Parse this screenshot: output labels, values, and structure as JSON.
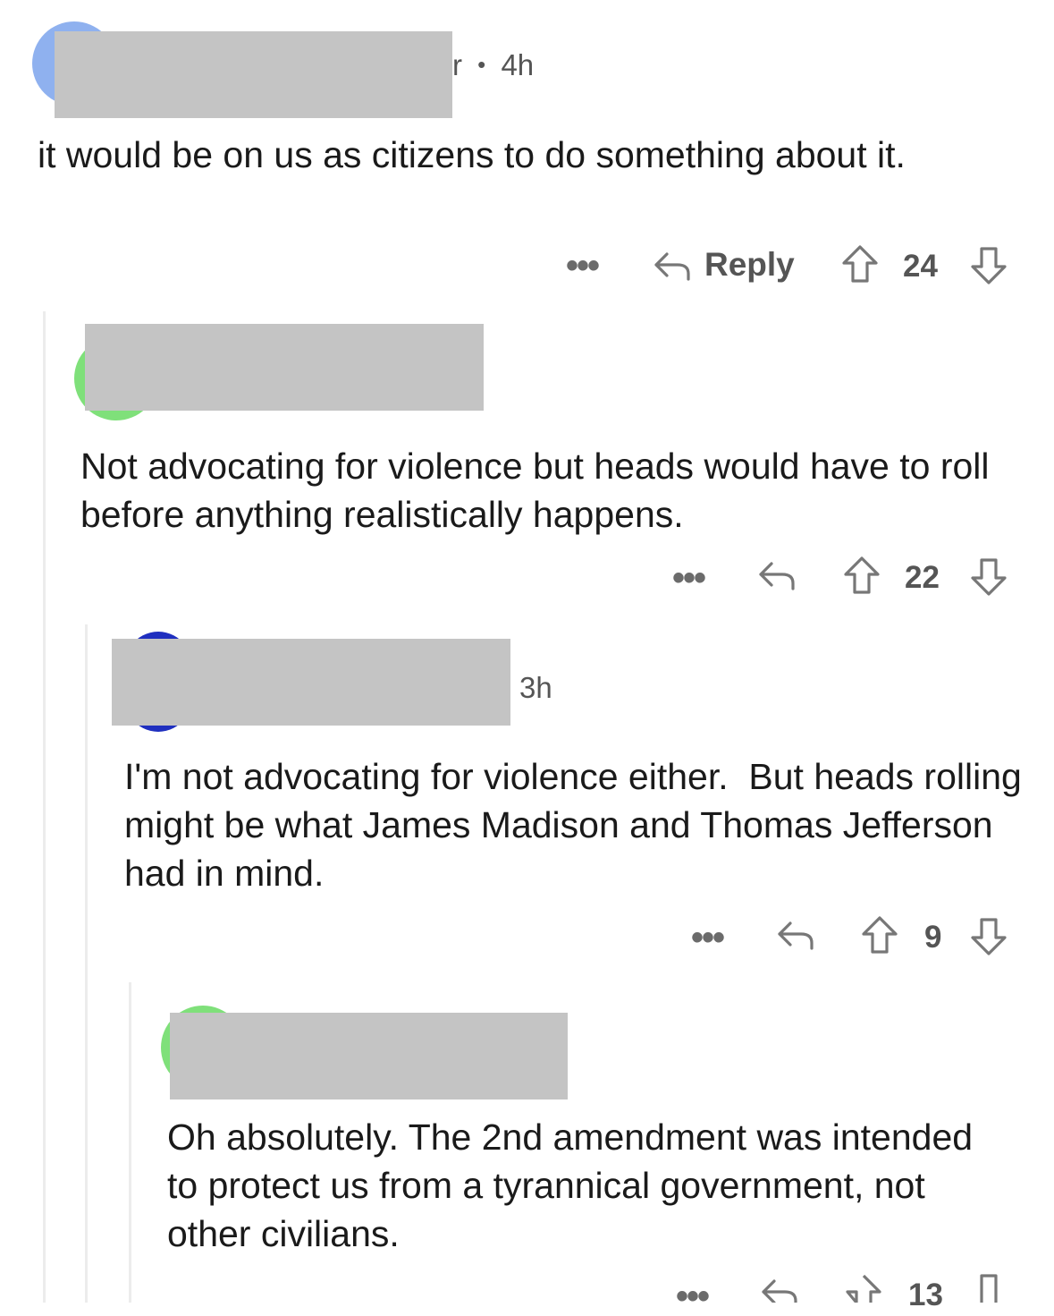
{
  "comments": [
    {
      "meta_suffix": "r",
      "separator": "•",
      "time": "4h",
      "body": "it would be on us as citizens to do something about it.",
      "actions": {
        "more": "•••",
        "reply": "Reply",
        "score": "24"
      }
    },
    {
      "body": "Not advocating for violence but heads would have to roll before anything realistically happens.",
      "actions": {
        "more": "•••",
        "score": "22"
      }
    },
    {
      "time": "3h",
      "body": "I'm not advocating for violence either.  But heads rolling might be what James Madison and Thomas Jefferson had in mind.",
      "actions": {
        "more": "•••",
        "score": "9"
      }
    },
    {
      "body": "Oh absolutely. The 2nd amendment was intended to protect us from a tyrannical government, not other civilians.",
      "actions": {
        "more": "•••",
        "score": "13"
      }
    }
  ],
  "icons": {
    "reply": "reply-arrow-icon",
    "upvote": "upvote-arrow-icon",
    "downvote": "downvote-arrow-icon",
    "more": "more-dots-icon"
  },
  "colors": {
    "avatar_blue": "#8fb1ef",
    "avatar_green": "#7fe07a",
    "avatar_darkblue": "#1f2fbf",
    "redaction": "#c4c4c4",
    "thread_line": "#ececec"
  }
}
